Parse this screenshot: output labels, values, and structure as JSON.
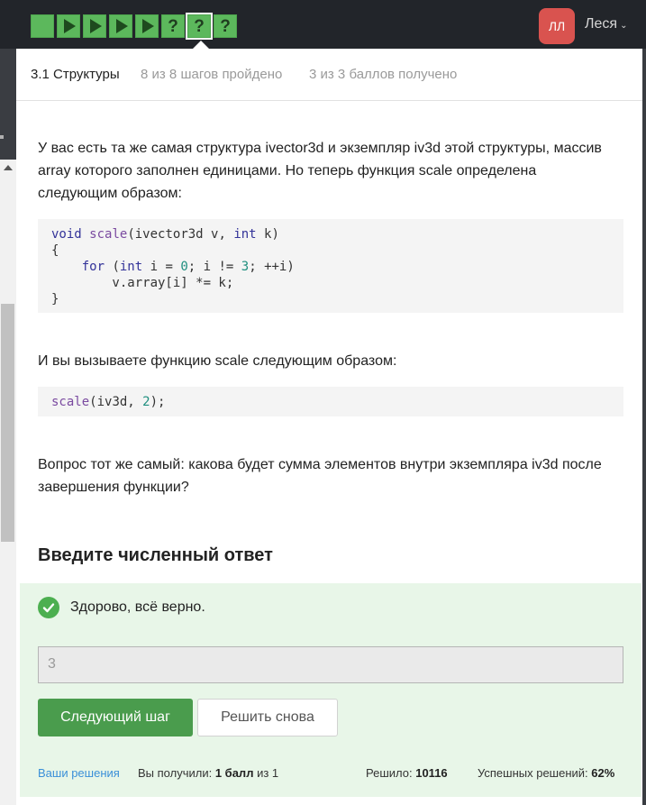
{
  "top_bar": {
    "steps": [
      {
        "kind": "text",
        "status": "passed"
      },
      {
        "kind": "video",
        "status": "passed"
      },
      {
        "kind": "video",
        "status": "passed"
      },
      {
        "kind": "video",
        "status": "passed"
      },
      {
        "kind": "video",
        "status": "passed"
      },
      {
        "kind": "quiz",
        "status": "passed"
      },
      {
        "kind": "quiz",
        "status": "passed",
        "current": true
      },
      {
        "kind": "quiz",
        "status": "passed"
      }
    ],
    "quiz_glyph": "?",
    "avatar_initials": "ЛЛ",
    "user_name": "Леся",
    "user_caret": "⌄",
    "colors": {
      "bar": "#22252a",
      "step": "#5cb85c",
      "avatar": "#d9534f"
    }
  },
  "lesson_header": {
    "title": "3.1 Структуры",
    "steps_progress": "8 из 8 шагов пройдено",
    "score_progress": "3 из 3 баллов  получено"
  },
  "content": {
    "paragraph_1_line_1": "У вас есть та же самая структура ivector3d и экземпляр iv3d этой структуры, массив",
    "paragraph_1_line_2": "array которого заполнен единицами. Но теперь функция scale определена",
    "paragraph_1_line_3": "следующим образом:",
    "code_block_1": [
      "void scale(ivector3d v, int k)",
      "{",
      "    for (int i = 0; i != 3; ++i)",
      "        v.array[i] *= k;",
      "}"
    ],
    "paragraph_2": "И вы вызываете функцию scale следующим образом:",
    "code_block_2": "scale(iv3d, 2);",
    "paragraph_3_line_1": "Вопрос тот же самый: какова будет сумма элементов внутри экземпляра iv3d после",
    "paragraph_3_line_2": "завершения функции?"
  },
  "answer": {
    "heading": "Введите численный ответ",
    "result_message": "Здорово, всё верно.",
    "result_icon": "check-circle-icon",
    "input_value": "3",
    "next_button": "Следующий шаг",
    "retry_button": "Решить снова",
    "colors": {
      "panel": "#e8f6e8",
      "success": "#4caf50",
      "button": "#4a9c4d",
      "link": "#3a8fd8"
    }
  },
  "footer": {
    "solutions_link": "Ваши решения",
    "got_prefix": "Вы получили:",
    "got_value": "1 балл",
    "got_suffix": "из 1",
    "solved_label": "Решило:",
    "solved_value": "10116",
    "success_label": "Успешных решений:",
    "success_value": "62%"
  }
}
